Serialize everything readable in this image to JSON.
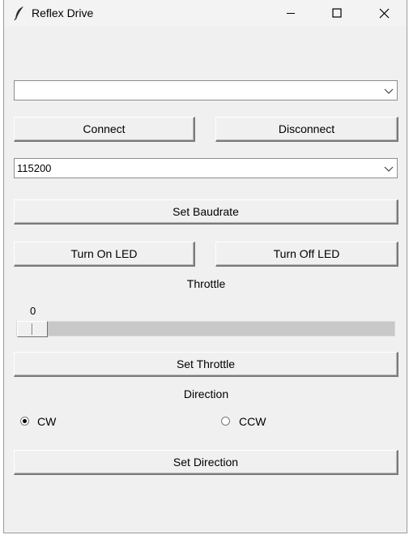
{
  "window": {
    "title": "Reflex Drive",
    "icon": "feather-icon",
    "controls": [
      "minimize-icon",
      "maximize-icon",
      "close-icon"
    ]
  },
  "port": {
    "selected": ""
  },
  "buttons": {
    "connect": "Connect",
    "disconnect": "Disconnect",
    "set_baudrate": "Set Baudrate",
    "led_on": "Turn On LED",
    "led_off": "Turn Off LED",
    "set_throttle": "Set Throttle",
    "set_direction": "Set Direction"
  },
  "baudrate": {
    "selected": "115200"
  },
  "throttle": {
    "label": "Throttle",
    "value": "0",
    "fraction": 0.0
  },
  "direction": {
    "label": "Direction",
    "options": [
      {
        "label": "CW",
        "checked": true
      },
      {
        "label": "CCW",
        "checked": false
      }
    ]
  }
}
